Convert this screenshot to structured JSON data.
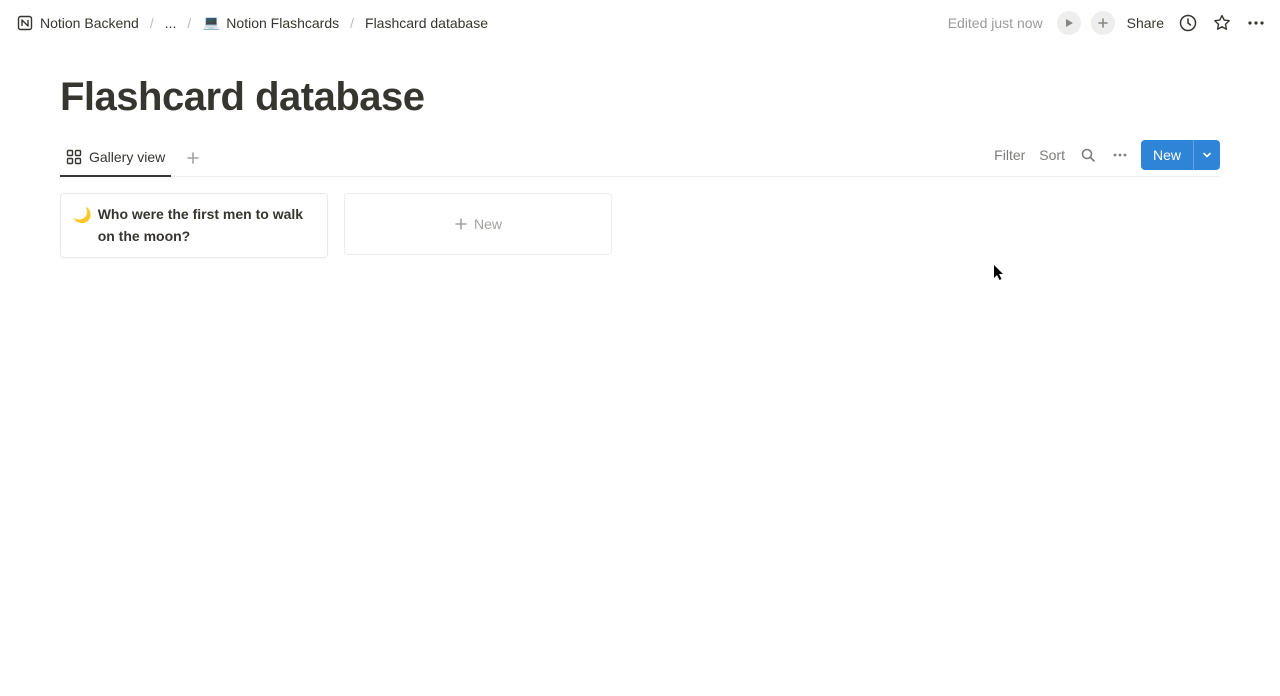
{
  "breadcrumb": {
    "root": "Notion Backend",
    "ellipsis": "...",
    "parent": "Notion Flashcards",
    "parent_emoji": "💻",
    "current": "Flashcard database"
  },
  "header": {
    "edited": "Edited just now",
    "share": "Share"
  },
  "page": {
    "title": "Flashcard database"
  },
  "view": {
    "active_tab": "Gallery view"
  },
  "controls": {
    "filter": "Filter",
    "sort": "Sort",
    "new": "New"
  },
  "gallery": {
    "cards": [
      {
        "emoji": "🌙",
        "title": "Who were the first men to walk on the moon?"
      }
    ],
    "new_card_label": "New"
  }
}
